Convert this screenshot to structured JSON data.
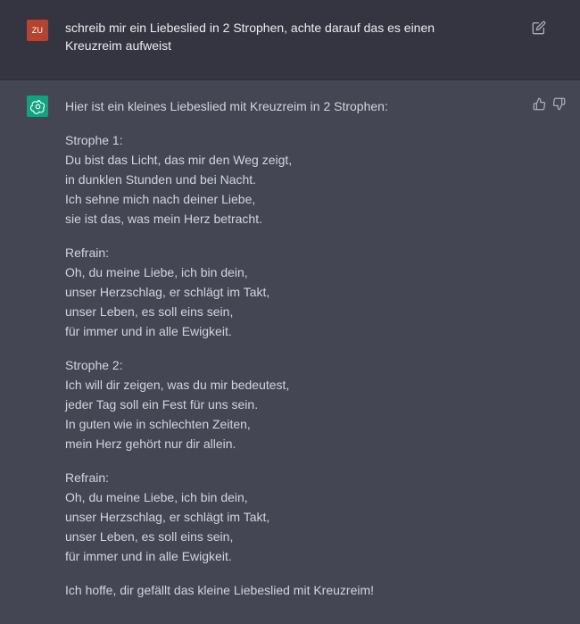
{
  "user_message": {
    "avatar_initials": "ZU",
    "text": "schreib mir ein Liebeslied in 2 Strophen, achte darauf das es einen Kreuzreim aufweist"
  },
  "assistant_message": {
    "intro": "Hier ist ein kleines Liebeslied mit Kreuzreim in 2 Strophen:",
    "blocks": [
      {
        "heading": "Strophe 1:",
        "lines": [
          "Du bist das Licht, das mir den Weg zeigt,",
          "in dunklen Stunden und bei Nacht.",
          "Ich sehne mich nach deiner Liebe,",
          "sie ist das, was mein Herz betracht."
        ]
      },
      {
        "heading": "Refrain:",
        "lines": [
          "Oh, du meine Liebe, ich bin dein,",
          "unser Herzschlag, er schlägt im Takt,",
          "unser Leben, es soll eins sein,",
          "für immer und in alle Ewigkeit."
        ]
      },
      {
        "heading": "Strophe 2:",
        "lines": [
          "Ich will dir zeigen, was du mir bedeutest,",
          "jeder Tag soll ein Fest für uns sein.",
          "In guten wie in schlechten Zeiten,",
          "mein Herz gehört nur dir allein."
        ]
      },
      {
        "heading": "Refrain:",
        "lines": [
          "Oh, du meine Liebe, ich bin dein,",
          "unser Herzschlag, er schlägt im Takt,",
          "unser Leben, es soll eins sein,",
          "für immer und in alle Ewigkeit."
        ]
      }
    ],
    "outro": "Ich hoffe, dir gefällt das kleine Liebeslied mit Kreuzreim!"
  },
  "icons": {
    "user_avatar": "user-avatar",
    "assistant_avatar": "openai-logo-icon",
    "edit": "edit-icon",
    "thumbs_up": "thumbs-up-icon",
    "thumbs_down": "thumbs-down-icon"
  },
  "colors": {
    "user_row_bg": "#343541",
    "assistant_row_bg": "#444654",
    "user_avatar_bg": "#b4442f",
    "assistant_avatar_bg": "#10a37f"
  }
}
